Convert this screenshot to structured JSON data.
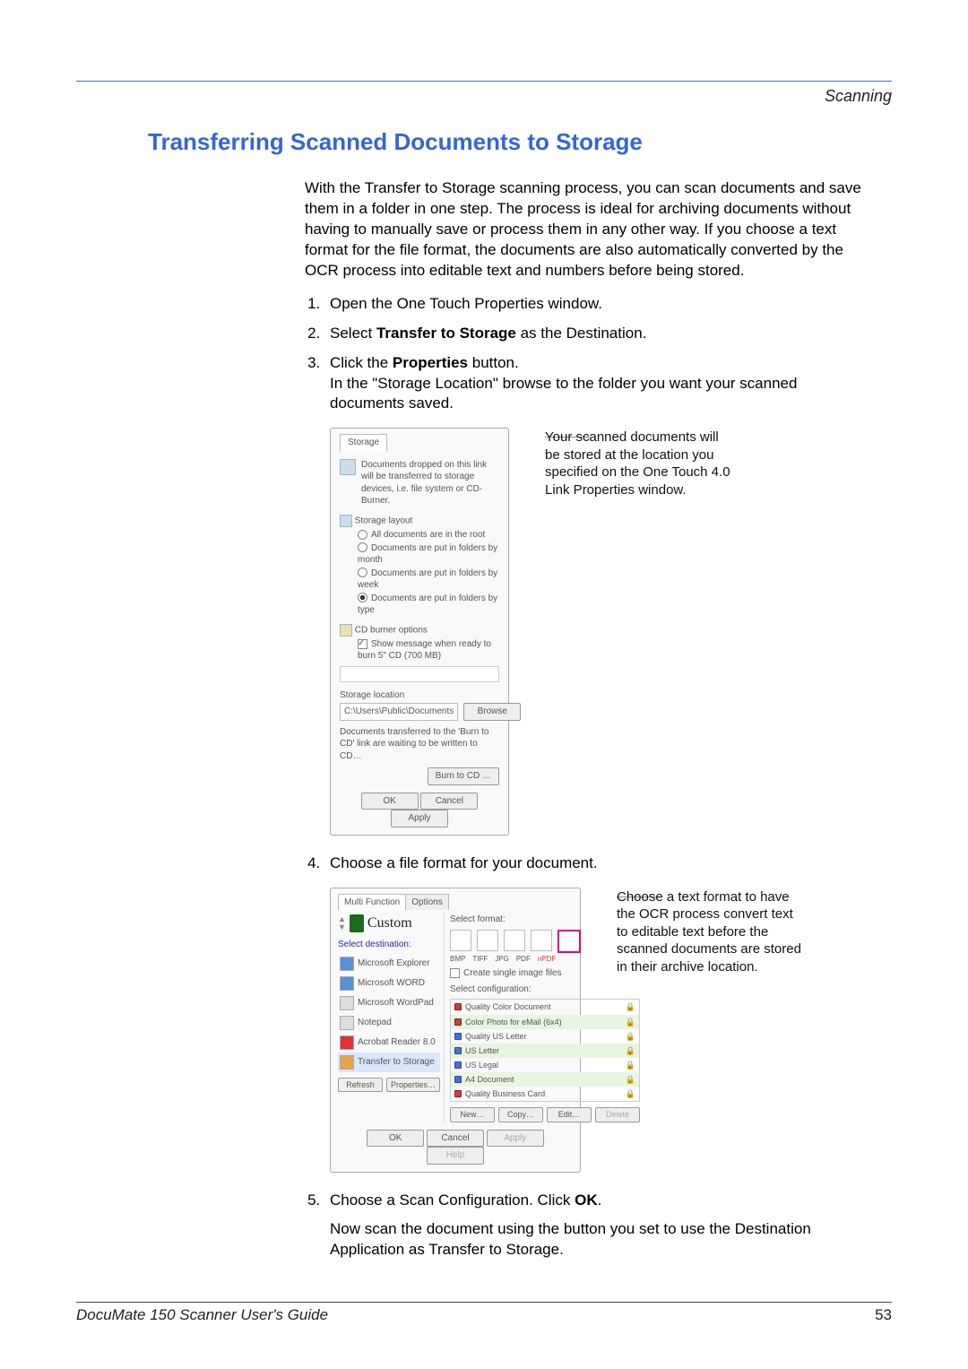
{
  "header": {
    "chapter": "Scanning"
  },
  "section_title": "Transferring Scanned Documents to Storage",
  "intro": "With the Transfer to Storage scanning process, you can scan documents and save them in a folder in one step. The process is ideal for archiving documents without having to manually save or process them in any other way. If you choose a text format for the file format, the documents are also automatically converted by the OCR process into editable text and numbers before being stored.",
  "steps": {
    "s1": "Open the One Touch Properties window.",
    "s2a": "Select ",
    "s2b": "Transfer to Storage",
    "s2c": " as the Destination.",
    "s3a": "Click the ",
    "s3b": "Properties",
    "s3c": " button.",
    "s3sub": "In the \"Storage Location\" browse to the folder you want your scanned documents saved.",
    "s4": "Choose a file format for your document.",
    "s5a": "Choose a Scan Configuration. Click ",
    "s5b": "OK",
    "s5c": "."
  },
  "after": "Now scan the document using the button you set to use the Destination Application as Transfer to Storage.",
  "callout1": "Your scanned documents will be stored at the location you specified on the One Touch 4.0 Link Properties window.",
  "callout2": "Choose a text format to have the OCR process convert text to editable text before the scanned documents are stored in their archive location.",
  "dialog1": {
    "tab": "Storage",
    "info": "Documents dropped on this link will be transferred to storage devices, i.e. file system or CD-Burner.",
    "layout_label": "Storage layout",
    "r1": "All documents are in the root",
    "r2": "Documents are put in folders by month",
    "r3": "Documents are put in folders by week",
    "r4": "Documents are put in folders by type",
    "cd_label": "CD burner options",
    "cd_check": "Show message when ready to burn 5\" CD (700 MB)",
    "loc_label": "Storage location",
    "path": "C:\\Users\\Public\\Documents",
    "browse": "Browse",
    "note": "Documents transferred to the 'Burn to CD' link are waiting to be written to CD…",
    "burn": "Burn to CD …",
    "ok": "OK",
    "cancel": "Cancel",
    "apply": "Apply"
  },
  "dialog2": {
    "tab1": "Multi Function",
    "tab2": "Options",
    "custom": "Custom",
    "dest_label": "Select destination:",
    "dest": [
      "Microsoft Explorer",
      "Microsoft WORD",
      "Microsoft WordPad",
      "Notepad",
      "Acrobat Reader 8.0",
      "Transfer to Storage"
    ],
    "fmt_label": "Select format:",
    "fmt_names": [
      "BMP",
      "TIFF",
      "JPG",
      "PDF",
      "nPDF"
    ],
    "fmt_check": "Create single image files",
    "cfg_label": "Select configuration:",
    "cfg": [
      "Quality Color Document",
      "Color Photo for eMail (6x4)",
      "Quality US Letter",
      "US Letter",
      "US Legal",
      "A4 Document",
      "Quality Business Card"
    ],
    "refresh": "Refresh",
    "properties": "Properties…",
    "new": "New…",
    "copy": "Copy…",
    "edit": "Edit…",
    "delete": "Delete",
    "ok": "OK",
    "cancel": "Cancel",
    "apply": "Apply",
    "help": "Help"
  },
  "footer": {
    "left": "DocuMate 150 Scanner User's Guide",
    "right": "53"
  }
}
